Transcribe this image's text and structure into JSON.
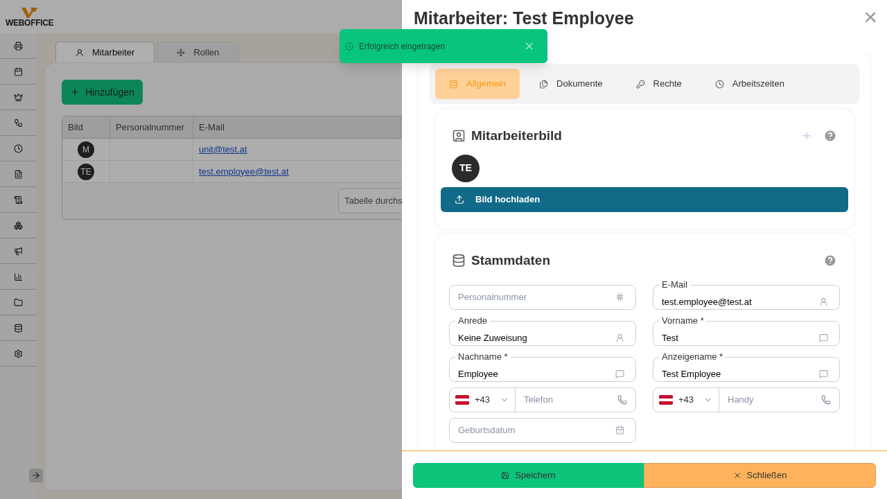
{
  "logo": {
    "text": "WEBOFFICE"
  },
  "page_tabs": [
    {
      "label": "Mitarbeiter",
      "selected": true
    },
    {
      "label": "Rollen",
      "selected": false
    }
  ],
  "add_button": "Hinzufügen",
  "table": {
    "columns": [
      "Bild",
      "Personalnummer",
      "E-Mail"
    ],
    "rows": [
      {
        "avatar": "M",
        "personalnummer": "",
        "email": "unit@test.at"
      },
      {
        "avatar": "TE",
        "personalnummer": "",
        "email": "test.employee@test.at"
      }
    ],
    "search_placeholder": "Tabelle durchs"
  },
  "toast": {
    "message": "Erfolgreich eingetragen",
    "close": "×"
  },
  "drawer": {
    "title": "Mitarbeiter: Test Employee",
    "close": "×",
    "tabs": [
      {
        "label": "Allgemein",
        "selected": true
      },
      {
        "label": "Dokumente",
        "selected": false
      },
      {
        "label": "Rechte",
        "selected": false
      },
      {
        "label": "Arbeitszeiten",
        "selected": false
      }
    ],
    "photo_section": {
      "title": "Mitarbeiterbild",
      "avatar": "TE",
      "upload_button": "Bild hochladen"
    },
    "master_data": {
      "title": "Stammdaten",
      "fields": [
        {
          "kind": "number",
          "placeholder": "Personalnummer"
        },
        {
          "kind": "email",
          "label": "E-Mail",
          "value": "test.employee@test.at"
        },
        {
          "kind": "salutation",
          "label": "Anrede",
          "value": "Keine Zuweisung"
        },
        {
          "kind": "name",
          "label": "Vorname *",
          "value": "Test"
        },
        {
          "kind": "name",
          "label": "Nachname *",
          "value": "Employee"
        },
        {
          "kind": "name",
          "label": "Anzeigename *",
          "value": "Test Employee"
        },
        {
          "kind": "phone",
          "country_code": "+43",
          "placeholder": "Telefon"
        },
        {
          "kind": "phone",
          "country_code": "+43",
          "placeholder": "Handy"
        },
        {
          "kind": "date",
          "placeholder": "Geburtsdatum"
        }
      ]
    },
    "buttons": [
      {
        "kind": "save",
        "label": "Speichern"
      },
      {
        "kind": "close",
        "label": "Schließen"
      }
    ]
  }
}
